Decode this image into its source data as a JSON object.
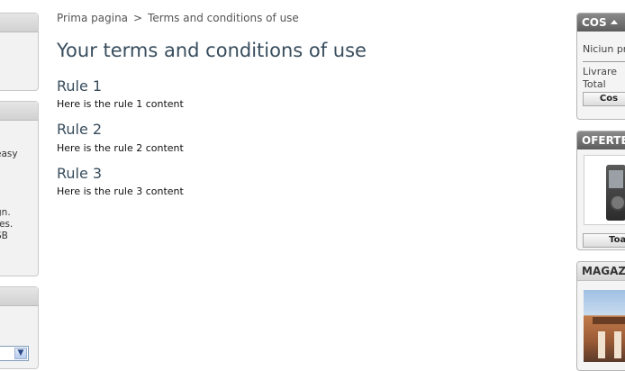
{
  "left": {
    "box2_text": "easy\n\n\n\n\ngn.\nres.\nSB"
  },
  "breadcrumb": {
    "home": "Prima pagina",
    "separator": ">",
    "current": "Terms and conditions of use"
  },
  "page": {
    "title": "Your terms and conditions of use",
    "rules": [
      {
        "title": "Rule 1",
        "content": "Here is the rule 1 content"
      },
      {
        "title": "Rule 2",
        "content": "Here is the rule 2 content"
      },
      {
        "title": "Rule 3",
        "content": "Here is the rule 3 content"
      }
    ]
  },
  "cart": {
    "title": "COS",
    "empty_text": "Niciun pr",
    "delivery_label": "Livrare",
    "total_label": "Total",
    "button_label": "Cos"
  },
  "offers": {
    "title": "OFERTE",
    "button_label": "Toat"
  },
  "stores": {
    "title": "MAGAZI"
  },
  "icons": {
    "cart_toggle": "caret-up-icon",
    "select_arrow": "chevron-down-icon"
  },
  "colors": {
    "heading": "#384d5d",
    "dark_header": "#6b6b6b"
  }
}
